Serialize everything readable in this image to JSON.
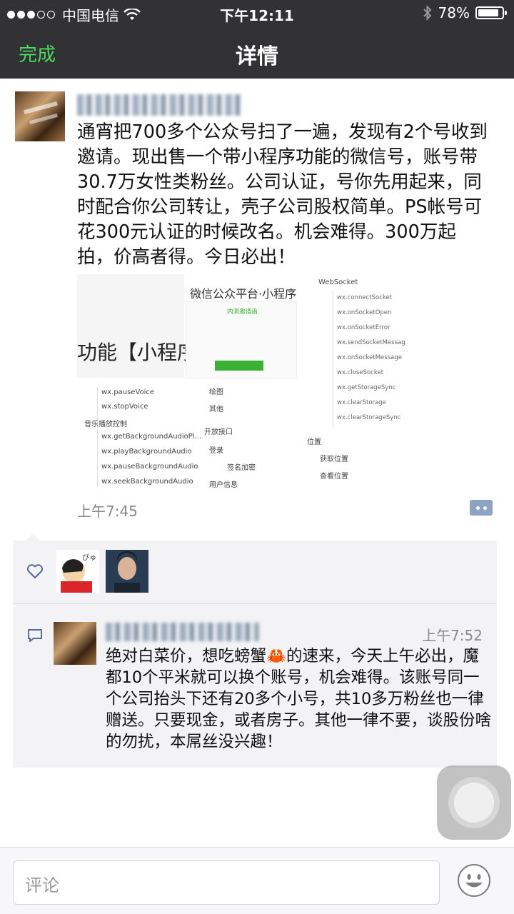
{
  "status_bar": {
    "carrier": "中国电信",
    "time": "下午12:11",
    "battery": "78%"
  },
  "nav": {
    "done_label": "完成",
    "title": "详情"
  },
  "post": {
    "text": "通宵把700多个公众号扫了一遍，发现有2个号收到邀请。现出售一个带小程序功能的微信号，账号带30.7万女性类粉丝。公司认证，号你先用起来，同时配合你公司转让，壳子公司股权简单。PS帐号可花300元认证的时候改名。机会难得。300万起拍，价高者得。今日必出！",
    "timestamp": "上午7:45",
    "image": {
      "big_text": "功能【小程序",
      "center_title": "微信公众平台·小程序",
      "center_subtitle": "内测邀请函",
      "left_menu": [
        "wx.pauseVoice",
        "wx.stopVoice",
        "音乐播放控制",
        "wx.getBackgroundAudioPl...",
        "wx.playBackgroundAudio",
        "wx.pauseBackgroundAudio",
        "wx.seekBackgroundAudio"
      ],
      "center_menu": [
        "绘图",
        "其他",
        "开放接口",
        "登录",
        "签名加密",
        "用户信息"
      ],
      "right_menu_title": "WebSocket",
      "right_menu": [
        "wx.connectSocket",
        "wx.onSocketOpen",
        "wx.onSocketError",
        "wx.sendSocketMessage",
        "wx.onSocketMessage",
        "wx.closeSocket",
        "wx.getStorageSync",
        "wx.clearStorage",
        "wx.clearStorageSync"
      ],
      "location_menu": [
        "位置",
        "获取位置",
        "查看位置"
      ]
    }
  },
  "comment": {
    "time": "上午7:52",
    "text": "绝对白菜价，想吃螃蟹🦀的速来，今天上午必出，魔都10个平米就可以换个账号，机会难得。该账号同一个公司抬头下还有20多个小号，共10多万粉丝也一律赠送。只要现金，或者房子。其他一律不要，谈股份啥的勿扰，本屌丝没兴趣！"
  },
  "input": {
    "placeholder": "评论"
  },
  "icons": {
    "heart": "heart-icon",
    "comment": "comment-icon",
    "emoji": "emoji-icon",
    "wifi": "wifi-icon",
    "bluetooth": "bluetooth-icon"
  },
  "colors": {
    "nav_bg": "#323234",
    "done": "#4cd964",
    "link_blue": "#576b95"
  }
}
